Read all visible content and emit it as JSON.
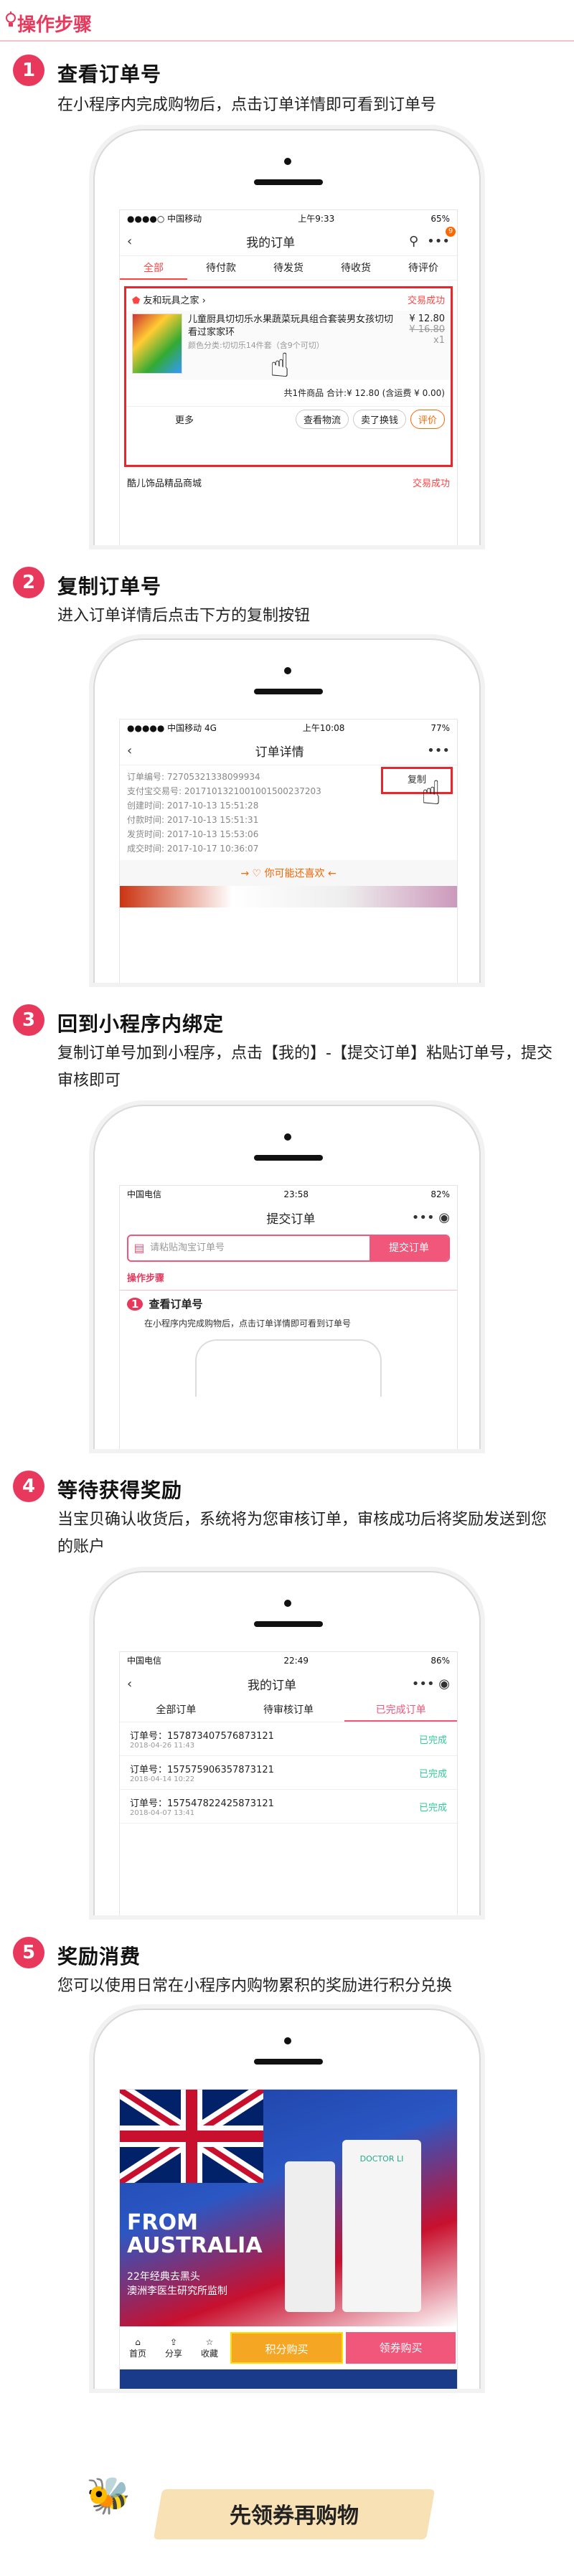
{
  "header": {
    "title": "操作步骤"
  },
  "steps": [
    {
      "num": "1",
      "title": "查看订单号",
      "desc": "在小程序内完成购物后，点击订单详情即可看到订单号"
    },
    {
      "num": "2",
      "title": "复制订单号",
      "desc": "进入订单详情后点击下方的复制按钮"
    },
    {
      "num": "3",
      "title": "回到小程序内绑定",
      "desc": "复制订单号加到小程序，点击【我的】-【提交订单】粘贴订单号，提交审核即可"
    },
    {
      "num": "4",
      "title": "等待获得奖励",
      "desc": "当宝贝确认收货后，系统将为您审核订单，审核成功后将奖励发送到您的账户"
    },
    {
      "num": "5",
      "title": "奖励消费",
      "desc": "您可以使用日常在小程序内购物累积的奖励进行积分兑换"
    }
  ],
  "s1": {
    "carrier": "●●●●○ 中国移动 ",
    "time": "上午9:33",
    "battery": "65%",
    "title": "我的订单",
    "badge": "9",
    "tabs": [
      "全部",
      "待付款",
      "待发货",
      "待收货",
      "待评价"
    ],
    "shop": "友和玩具之家",
    "status": "交易成功",
    "product": "儿童厨具切切乐水果蔬菜玩具组合套装男女孩切切看过家家环",
    "variant": "颜色分类:切切乐14件套（含9个可切）",
    "price": "¥ 12.80",
    "orig": "¥ 16.80",
    "qty": "x1",
    "summary": "共1件商品 合计:¥ 12.80 (含运费 ¥ 0.00)",
    "more": "更多",
    "btns": [
      "查看物流",
      "卖了换钱",
      "评价"
    ],
    "shop2": "酷儿饰品精品商城",
    "status2": "交易成功"
  },
  "s2": {
    "carrier": "●●●●● 中国移动 4G",
    "time": "上午10:08",
    "battery": "77%",
    "title": "订单详情",
    "copy": "复制",
    "rows": [
      [
        "订单编号:",
        "72705321338099934"
      ],
      [
        "支付宝交易号:",
        "2017101321001001500237203"
      ],
      [
        "创建时间:",
        "2017-10-13 15:51:28"
      ],
      [
        "付款时间:",
        "2017-10-13 15:51:31"
      ],
      [
        "发货时间:",
        "2017-10-13 15:53:06"
      ],
      [
        "成交时间:",
        "2017-10-17 10:36:07"
      ]
    ],
    "like": "→ ♡ 你可能还喜欢 ←"
  },
  "s3": {
    "carrier": "中国电信",
    "time": "23:58",
    "battery": "82%",
    "title": "提交订单",
    "placeholder": "请粘贴淘宝订单号",
    "submit": "提交订单",
    "mini": "操作步骤",
    "mini_title": "查看订单号",
    "mini_desc": "在小程序内完成购物后，点击订单详情即可看到订单号"
  },
  "s4": {
    "carrier": "中国电信",
    "time": "22:49",
    "battery": "86%",
    "title": "我的订单",
    "tabs": [
      "全部订单",
      "待审核订单",
      "已完成订单"
    ],
    "orders": [
      {
        "no": "订单号：157873407576873121",
        "date": "2018-04-26 11:43",
        "st": "已完成"
      },
      {
        "no": "订单号：157575906357873121",
        "date": "2018-04-14 10:22",
        "st": "已完成"
      },
      {
        "no": "订单号：157547822425873121",
        "date": "2018-04-07 13:41",
        "st": "已完成"
      }
    ]
  },
  "s5": {
    "from": "FROM AUSTRALIA",
    "sub1": "22年经典去黑头",
    "sub2": "澳洲李医生研究所监制",
    "brand": "DOCTOR LI",
    "nav": [
      "首页",
      "分享",
      "收藏"
    ],
    "b1": "积分购买",
    "b2": "领券购买"
  },
  "footer": {
    "text": "先领券再购物"
  }
}
